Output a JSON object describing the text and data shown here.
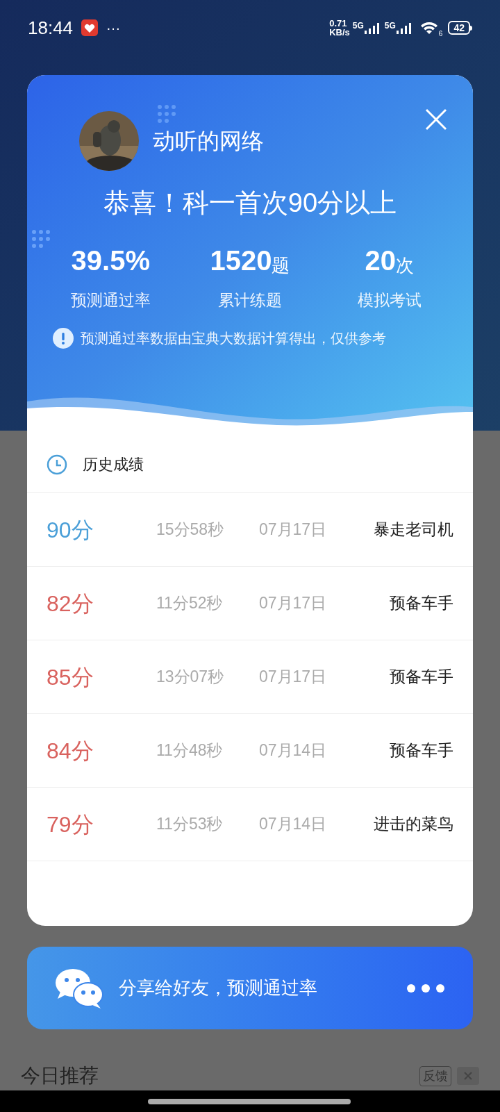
{
  "status_bar": {
    "time": "18:44",
    "more": "···",
    "net_speed": "0.71",
    "net_unit": "KB/s",
    "sim1": "5G",
    "sim2": "5G",
    "wifi_label": "6",
    "battery": "42"
  },
  "popup": {
    "user_name": "动听的网络",
    "headline": "恭喜！科一首次90分以上",
    "stats": [
      {
        "value": "39.5%",
        "label": "预测通过率"
      },
      {
        "value": "1520",
        "unit": "题",
        "label": "累计练题"
      },
      {
        "value": "20",
        "unit": "次",
        "label": "模拟考试"
      }
    ],
    "note": "预测通过率数据由宝典大数据计算得出，仅供参考",
    "history_title": "历史成绩",
    "history": [
      {
        "score": "90分",
        "color": "#4a9fd8",
        "duration": "15分58秒",
        "date": "07月17日",
        "title": "暴走老司机"
      },
      {
        "score": "82分",
        "color": "#d9625e",
        "duration": "11分52秒",
        "date": "07月17日",
        "title": "预备车手"
      },
      {
        "score": "85分",
        "color": "#d9625e",
        "duration": "13分07秒",
        "date": "07月17日",
        "title": "预备车手"
      },
      {
        "score": "84分",
        "color": "#d9625e",
        "duration": "11分48秒",
        "date": "07月14日",
        "title": "预备车手"
      },
      {
        "score": "79分",
        "color": "#d9625e",
        "duration": "11分53秒",
        "date": "07月14日",
        "title": "进击的菜鸟"
      }
    ]
  },
  "share_bar": {
    "label": "分享给好友，预测通过率"
  },
  "background": {
    "section_title": "今日推荐",
    "feedback": "反馈"
  }
}
